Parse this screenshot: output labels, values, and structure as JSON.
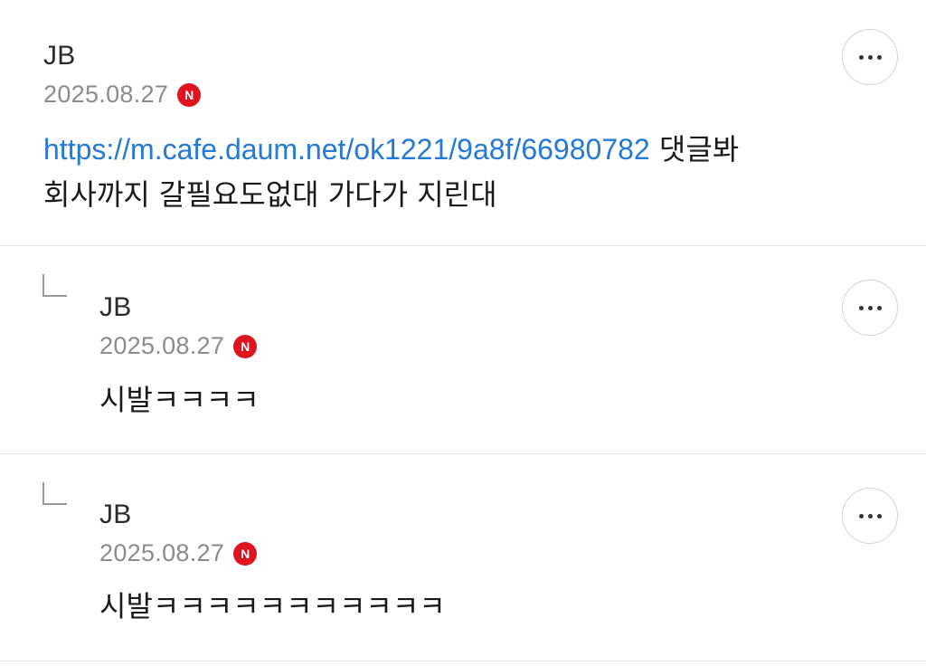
{
  "comments": [
    {
      "author": "JB",
      "date": "2025.08.27",
      "badge": "N",
      "link": "https://m.cafe.daum.net/ok1221/9a8f/66980782",
      "text_after_link": " 댓글봐",
      "line2": "회사까지 갈필요도없대 가다가 지린대"
    },
    {
      "author": "JB",
      "date": "2025.08.27",
      "badge": "N",
      "text": "시발ㅋㅋㅋㅋ"
    },
    {
      "author": "JB",
      "date": "2025.08.27",
      "badge": "N",
      "text": "시발ㅋㅋㅋㅋㅋㅋㅋㅋㅋㅋㅋ"
    }
  ],
  "icons": {
    "more": "more-horizontal-icon",
    "reply": "reply-arrow-icon",
    "new_badge": "new-badge-icon"
  },
  "colors": {
    "link": "#2479d9",
    "badge": "#e0141e",
    "date": "#8a8a8f",
    "divider": "#e2e2e5"
  }
}
